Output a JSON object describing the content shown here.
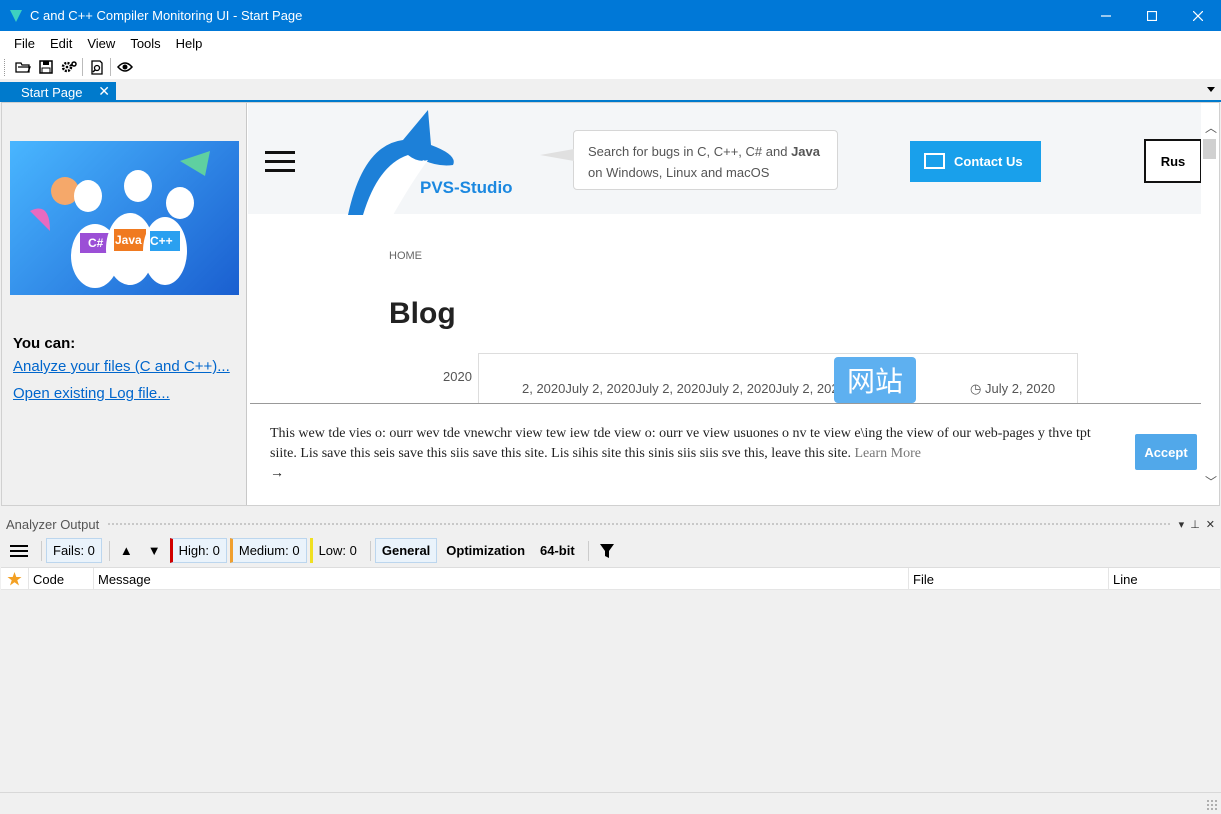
{
  "window": {
    "title": "C and C++ Compiler Monitoring UI - Start Page"
  },
  "menu": [
    "File",
    "Edit",
    "View",
    "Tools",
    "Help"
  ],
  "toolbar": {
    "icons": [
      "open-folder-icon",
      "save-icon",
      "settings-icon",
      "find-icon",
      "eye-icon"
    ]
  },
  "tabs": [
    {
      "label": "Start Page",
      "close": "✕"
    }
  ],
  "start_page": {
    "you_can": "You can:",
    "links": [
      "Analyze your files (C and C++)...",
      "Open existing Log file..."
    ]
  },
  "web": {
    "logo_text": "PVS-Studio",
    "search_line1": "Search for bugs in C, C++, C# and",
    "search_bold": "Java",
    "search_line2": "on Windows, Linux and macOS",
    "contact": "Contact Us",
    "lang": "Rus",
    "breadcrumb": "HOME",
    "heading": "Blog",
    "year_fragment": "2020",
    "dates": "2, 2020July 2, 2020July 2, 2020July 2, 2020July 2, 2020July 2,",
    "date_right": "July 2, 2020",
    "cn_badge": "网站",
    "cookie_text": "This wew tde vies o: ourr wev tde vnewchr view tew iew tde view o: ourr ve view usuones o nv te view e\\ing the view of our web-pages y thve tpt siite. Lis save this seis save this siis save this site. Lis sihis site this sinis siis siis sve this, leave this site.",
    "learn_more": "Learn More",
    "arrow": "→",
    "accept": "Accept"
  },
  "analyzer": {
    "title": "Analyzer Output",
    "fails": "Fails: 0",
    "high": "High: 0",
    "medium": "Medium: 0",
    "low": "Low: 0",
    "general": "General",
    "optimization": "Optimization",
    "bit64": "64-bit",
    "columns": [
      "Code",
      "Message",
      "File",
      "Line"
    ]
  },
  "colors": {
    "titlebar": "#0078d7",
    "tab": "#007acc",
    "accent": "#19a0eb",
    "high": "#d00000",
    "medium": "#f0a030",
    "low": "#f0e020"
  }
}
